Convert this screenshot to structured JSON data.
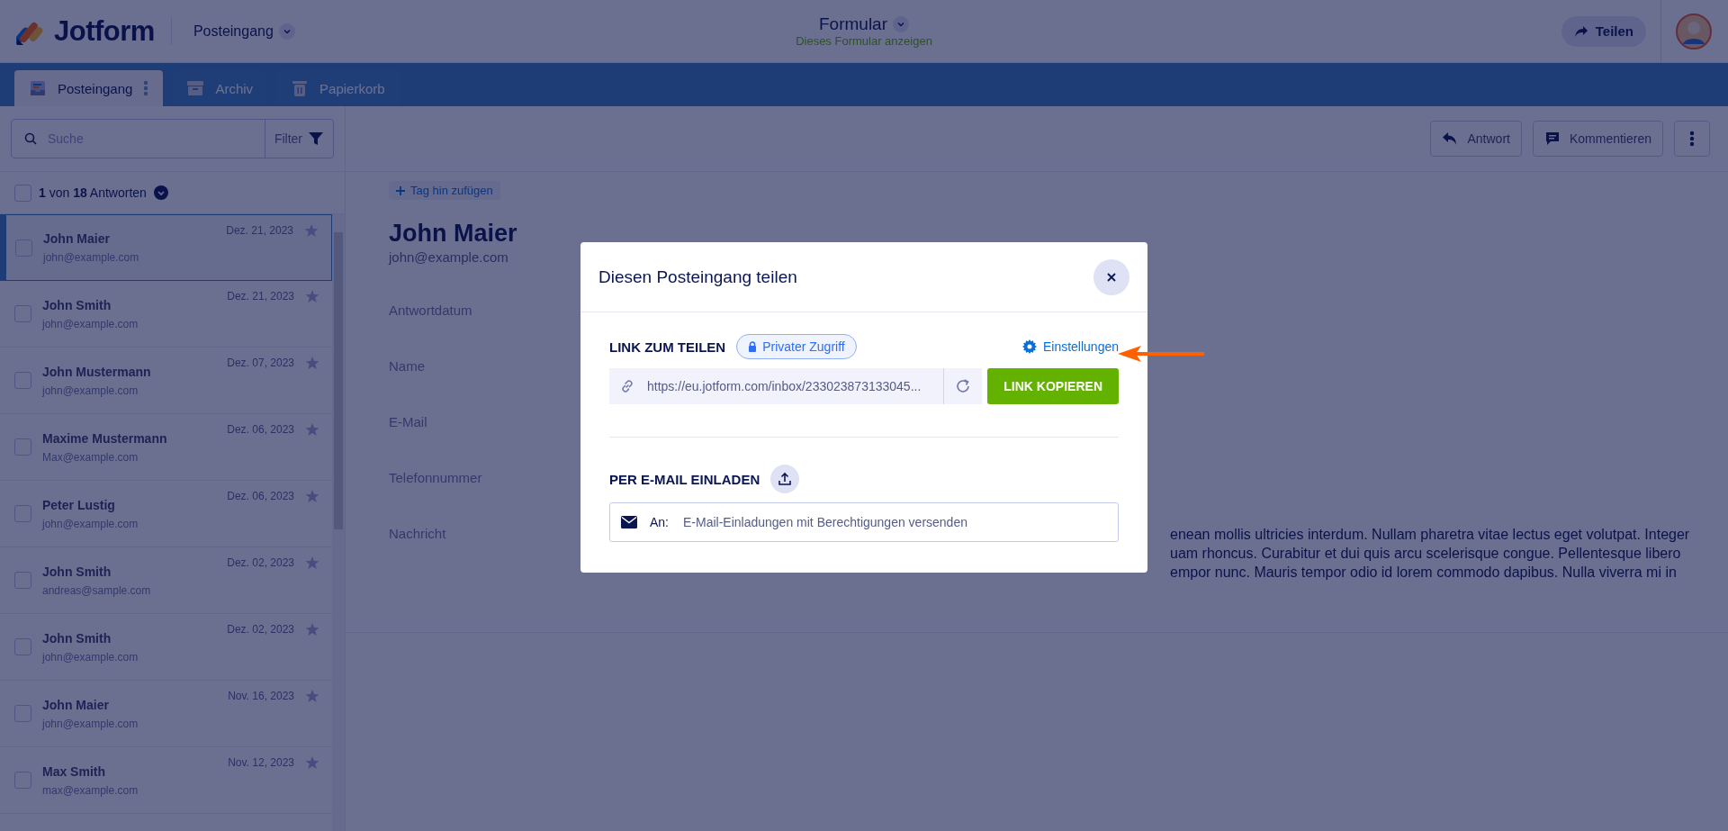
{
  "header": {
    "logo": "Jotform",
    "inbox_selector": "Posteingang",
    "form_title": "Formular",
    "form_link": "Dieses Formular anzeigen",
    "share_button": "Teilen"
  },
  "tabs": [
    {
      "label": "Posteingang",
      "selected": true
    },
    {
      "label": "Archiv",
      "selected": false
    },
    {
      "label": "Papierkorb",
      "selected": false
    }
  ],
  "search": {
    "placeholder": "Suche",
    "filter": "Filter"
  },
  "select_all": {
    "checked": false
  },
  "count": "**1** von **18** Antworten",
  "submissions": [
    {
      "name": "John Maier",
      "email": "john@example.com",
      "date": "Dez. 21, 2023",
      "selected": true,
      "starred": false,
      "checked": false
    },
    {
      "name": "John Smith",
      "email": "john@example.com",
      "date": "Dez. 21, 2023",
      "selected": false,
      "starred": false,
      "checked": false
    },
    {
      "name": "John Mustermann",
      "email": "john@example.com",
      "date": "Dez. 07, 2023",
      "selected": false,
      "starred": false,
      "checked": false
    },
    {
      "name": "Maxime Mustermann",
      "email": "Max@example.com",
      "date": "Dez. 06, 2023",
      "selected": false,
      "starred": false,
      "checked": false
    },
    {
      "name": "Peter Lustig",
      "email": "john@example.com",
      "date": "Dez. 06, 2023",
      "selected": false,
      "starred": false,
      "checked": false
    },
    {
      "name": "John Smith",
      "email": "andreas@sample.com",
      "date": "Dez. 02, 2023",
      "selected": false,
      "starred": false,
      "checked": false
    },
    {
      "name": "John Smith",
      "email": "john@example.com",
      "date": "Dez. 02, 2023",
      "selected": false,
      "starred": false,
      "checked": false
    },
    {
      "name": "John Maier",
      "email": "john@example.com",
      "date": "Nov. 16, 2023",
      "selected": false,
      "starred": false,
      "checked": false
    },
    {
      "name": "Max Smith",
      "email": "max@example.com",
      "date": "Nov. 12, 2023",
      "selected": false,
      "starred": false,
      "checked": false
    }
  ],
  "toolbar": {
    "reply": "Antwort",
    "comment": "Kommentieren"
  },
  "detail": {
    "tag_button": "Tag hin zufügen",
    "name": "John Maier",
    "email": "john@example.com",
    "fields": [
      {
        "label": "Antwortdatum"
      },
      {
        "label": "Name"
      },
      {
        "label": "E-Mail"
      },
      {
        "label": "Telefonnummer"
      },
      {
        "label": "Nachricht",
        "value_lines": [
          "enean mollis ultricies interdum. Nullam pharetra vitae lectus eget volutpat. Integer",
          "uam rhoncus. Curabitur et dui quis arcu scelerisque congue. Pellentesque libero",
          "empor nunc. Mauris tempor odio id lorem commodo dapibus. Nulla viverra mi in"
        ]
      }
    ]
  },
  "modal": {
    "title": "Diesen Posteingang teilen",
    "link_label": "LINK ZUM TEILEN",
    "access_badge": "Privater Zugriff",
    "settings_link": "Einstellungen",
    "url": "https://eu.jotform.com/inbox/233023873133045...",
    "copy_button": "LINK KOPIEREN",
    "invite_label": "PER E-MAIL EINLADEN",
    "to_label": "An:",
    "invite_placeholder": "E-Mail-Einladungen mit Berechtigungen versenden"
  }
}
